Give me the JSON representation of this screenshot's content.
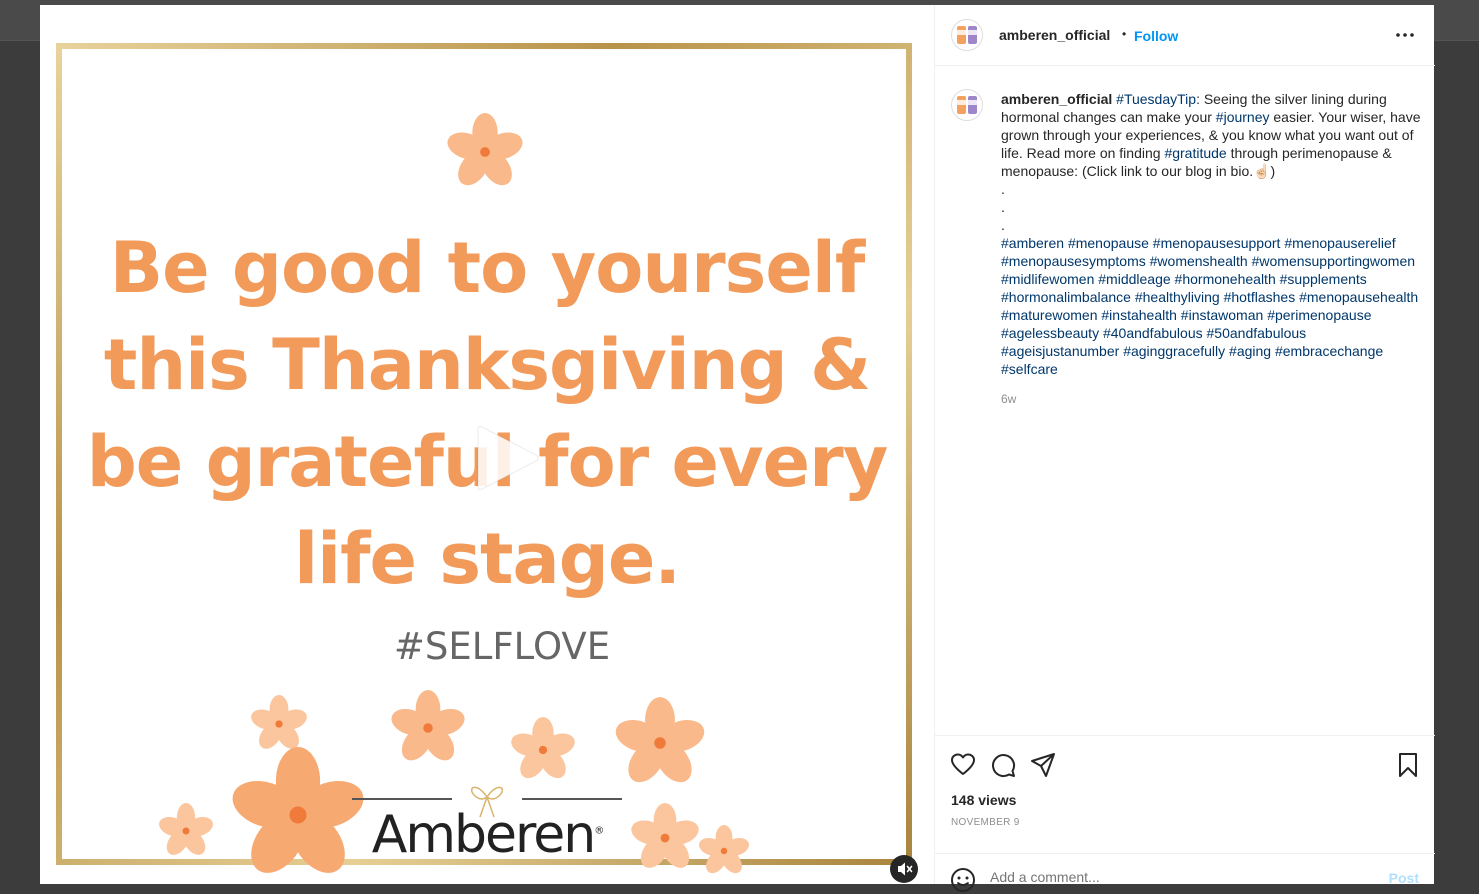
{
  "post": {
    "quote": "Be good to yourself\nthis Thanksgiving &\nbe grateful for every\nlife stage.",
    "image_hashtag": "#SELFLOVE",
    "brand": "Amberen",
    "brand_mark": "®"
  },
  "header": {
    "username": "amberen_official",
    "separator": "•",
    "follow_label": "Follow"
  },
  "caption": {
    "username": "amberen_official",
    "segments": [
      {
        "text": "#TuesdayTip",
        "tag": true
      },
      {
        "text": ": Seeing the silver lining during hormonal changes can make your ",
        "tag": false
      },
      {
        "text": "#journey",
        "tag": true
      },
      {
        "text": " easier. Your wiser, have grown through your experiences, & you know what you want out of life. Read more on finding ",
        "tag": false
      },
      {
        "text": "#gratitude",
        "tag": true
      },
      {
        "text": " through perimenopause & menopause: (Click link to our blog in bio.☝🏻)",
        "tag": false
      },
      {
        "text": "\n.\n.\n.\n",
        "tag": false
      },
      {
        "text": "#amberen",
        "tag": true
      },
      {
        "text": " ",
        "tag": false
      },
      {
        "text": "#menopause",
        "tag": true
      },
      {
        "text": " ",
        "tag": false
      },
      {
        "text": "#menopausesupport",
        "tag": true
      },
      {
        "text": " ",
        "tag": false
      },
      {
        "text": "#menopauserelief",
        "tag": true
      },
      {
        "text": " ",
        "tag": false
      },
      {
        "text": "#menopausesymptoms",
        "tag": true
      },
      {
        "text": " ",
        "tag": false
      },
      {
        "text": "#womenshealth",
        "tag": true
      },
      {
        "text": " ",
        "tag": false
      },
      {
        "text": "#womensupportingwomen",
        "tag": true
      },
      {
        "text": " ",
        "tag": false
      },
      {
        "text": "#midlifewomen",
        "tag": true
      },
      {
        "text": " ",
        "tag": false
      },
      {
        "text": "#middleage",
        "tag": true
      },
      {
        "text": " ",
        "tag": false
      },
      {
        "text": "#hormonehealth",
        "tag": true
      },
      {
        "text": " ",
        "tag": false
      },
      {
        "text": "#supplements",
        "tag": true
      },
      {
        "text": " ",
        "tag": false
      },
      {
        "text": "#hormonalimbalance",
        "tag": true
      },
      {
        "text": " ",
        "tag": false
      },
      {
        "text": "#healthyliving",
        "tag": true
      },
      {
        "text": " ",
        "tag": false
      },
      {
        "text": "#hotflashes",
        "tag": true
      },
      {
        "text": " ",
        "tag": false
      },
      {
        "text": "#menopausehealth",
        "tag": true
      },
      {
        "text": " ",
        "tag": false
      },
      {
        "text": "#maturewomen",
        "tag": true
      },
      {
        "text": " ",
        "tag": false
      },
      {
        "text": "#instahealth",
        "tag": true
      },
      {
        "text": " ",
        "tag": false
      },
      {
        "text": "#instawoman",
        "tag": true
      },
      {
        "text": " ",
        "tag": false
      },
      {
        "text": "#perimenopause",
        "tag": true
      },
      {
        "text": " ",
        "tag": false
      },
      {
        "text": "#agelessbeauty",
        "tag": true
      },
      {
        "text": " ",
        "tag": false
      },
      {
        "text": "#40andfabulous",
        "tag": true
      },
      {
        "text": " ",
        "tag": false
      },
      {
        "text": "#50andfabulous",
        "tag": true
      },
      {
        "text": " ",
        "tag": false
      },
      {
        "text": "#ageisjustanumber",
        "tag": true
      },
      {
        "text": " ",
        "tag": false
      },
      {
        "text": "#aginggracefully",
        "tag": true
      },
      {
        "text": " ",
        "tag": false
      },
      {
        "text": "#aging",
        "tag": true
      },
      {
        "text": " ",
        "tag": false
      },
      {
        "text": "#embracechange",
        "tag": true
      },
      {
        "text": " ",
        "tag": false
      },
      {
        "text": "#selfcare",
        "tag": true
      }
    ],
    "time": "6w"
  },
  "stats": {
    "views": "148 views",
    "date": "NOVEMBER 9"
  },
  "comment": {
    "placeholder": "Add a comment...",
    "post_label": "Post"
  },
  "icons": {
    "more": "more-options-icon",
    "like": "heart-icon",
    "comment": "comment-icon",
    "share": "share-icon",
    "save": "bookmark-icon",
    "emoji": "emoji-icon",
    "play": "play-icon",
    "mute": "muted-speaker-icon"
  },
  "colors": {
    "quote": "#f29a5a",
    "link": "#0095f6",
    "hashtag": "#00376b",
    "frame": "#c8ad6a"
  }
}
